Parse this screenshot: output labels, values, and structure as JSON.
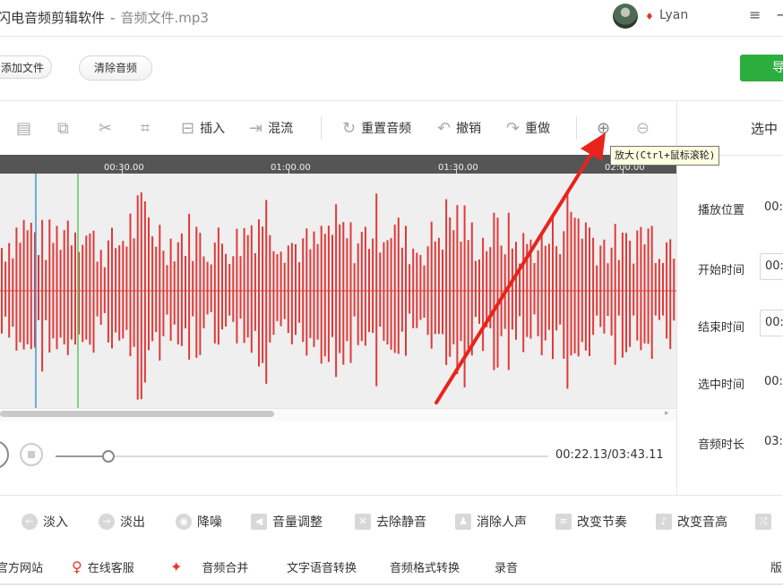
{
  "title_bar": {
    "app_name": "闪电音频剪辑软件",
    "separator": "-",
    "file_name": "音频文件.mp3",
    "user_name": "Lyan",
    "menu_icon": "≡",
    "minimize_icon": "−"
  },
  "buttons": {
    "add_file": "添加文件",
    "clear_audio": "清除音频",
    "export": "导"
  },
  "toolbar": {
    "insert": "插入",
    "mix": "混流",
    "reset_audio": "重置音频",
    "undo": "撤销",
    "redo": "重做"
  },
  "tooltip": "放大(Ctrl+鼠标滚轮)",
  "timeline": {
    "labels": [
      "00:30.00",
      "01:00.00",
      "01:30.00",
      "02:00.00"
    ]
  },
  "player": {
    "time": "00:22.13/03:43.11",
    "progress": 0.105
  },
  "right_panel": {
    "header": "选中",
    "play_position_label": "播放位置",
    "play_position_value": "00:",
    "start_time_label": "开始时间",
    "start_time_value": "00:",
    "end_time_label": "结束时间",
    "end_time_value": "00:",
    "selected_time_label": "选中时间",
    "selected_time_value": "00:",
    "duration_label": "音频时长",
    "duration_value": "03:"
  },
  "effects": {
    "fade_in": "淡入",
    "fade_out": "淡出",
    "denoise": "降噪",
    "volume": "音量调整",
    "remove_silence": "去除静音",
    "remove_vocals": "消除人声",
    "tempo": "改变节奏",
    "pitch": "改变音高"
  },
  "footer": {
    "official_site": "官方网站",
    "online_service": "在线客服",
    "audio_merge": "音频合并",
    "tts": "文字语音转换",
    "format_convert": "音频格式转换",
    "record": "录音",
    "version": "版"
  },
  "colors": {
    "waveform": "#e03a3a",
    "export_button": "#2cae3f",
    "playhead": "#3a9ad9",
    "marker": "#5cc95c",
    "annotation_arrow": "#e8241c"
  }
}
